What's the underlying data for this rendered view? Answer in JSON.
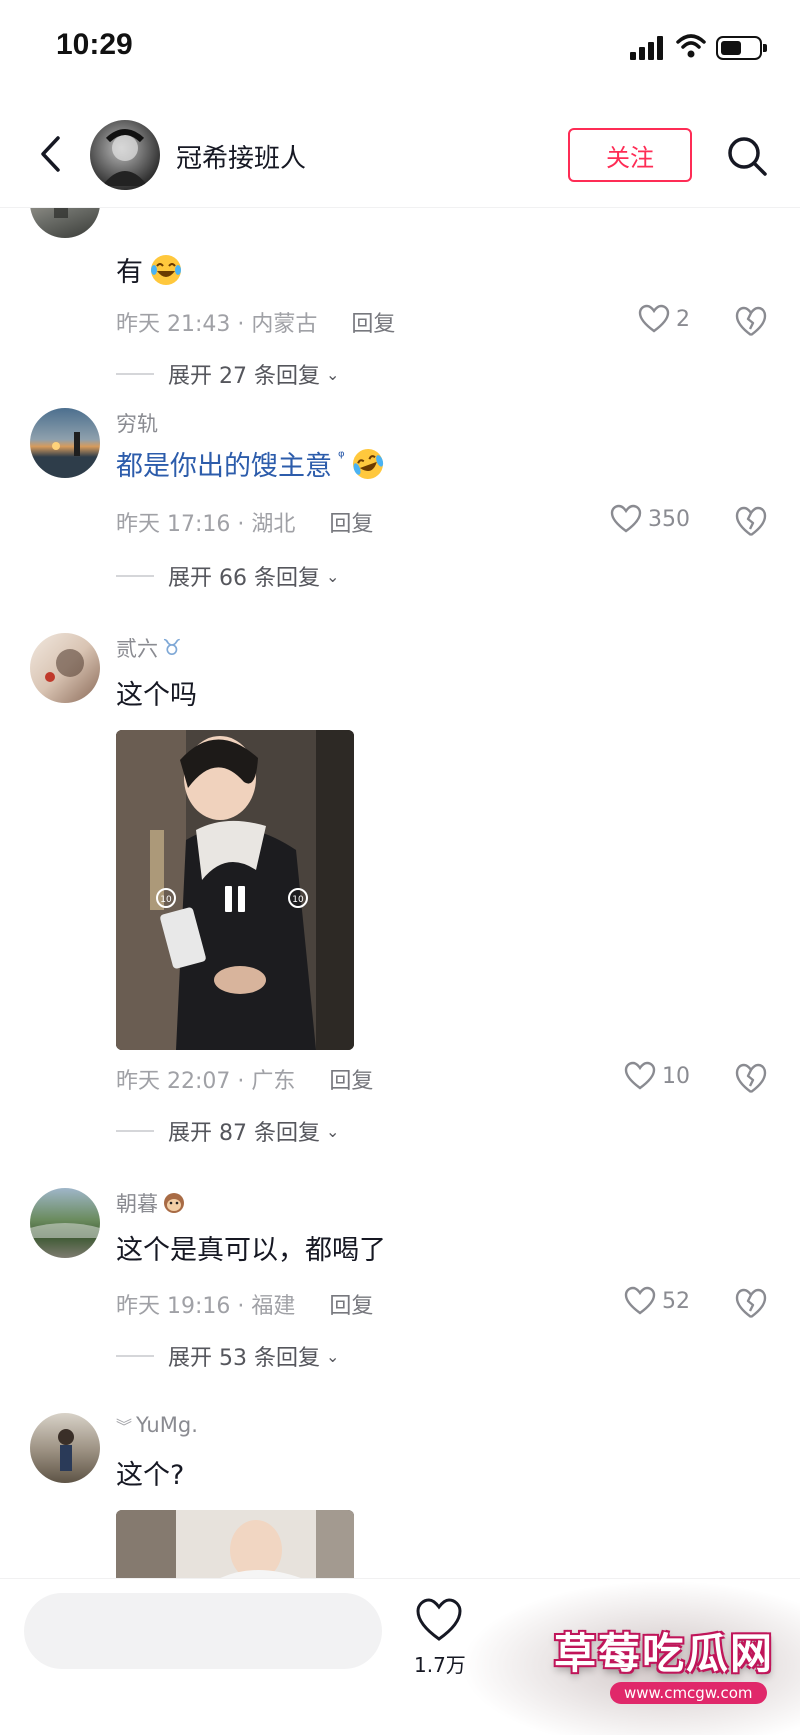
{
  "status_bar": {
    "time": "10:29"
  },
  "header": {
    "account_name": "冠希接班人",
    "follow_label": "关注"
  },
  "comments": [
    {
      "user": "",
      "text": "有",
      "emoji": "laughing-tears",
      "time_location": "昨天 21:43 · 内蒙古",
      "reply_label": "回复",
      "likes": "2",
      "expand_label": "展开 27 条回复"
    },
    {
      "user": "穷轨",
      "text": "都是你出的馊主意",
      "emoji": "crying-laughing",
      "time_location": "昨天 17:16 · 湖北",
      "reply_label": "回复",
      "likes": "350",
      "expand_label": "展开 66 条回复"
    },
    {
      "user": "贰六",
      "text": "这个吗",
      "time_location": "昨天 22:07 · 广东",
      "reply_label": "回复",
      "likes": "10",
      "expand_label": "展开 87 条回复"
    },
    {
      "user": "朝暮",
      "text": "这个是真可以，都喝了",
      "time_location": "昨天 19:16 · 福建",
      "reply_label": "回复",
      "likes": "52",
      "expand_label": "展开 53 条回复"
    },
    {
      "user": "YuMg.",
      "text": "这个?"
    }
  ],
  "bottom_bar": {
    "like_count": "1.7万"
  },
  "watermark": {
    "title": "草莓吃瓜网",
    "url": "www.cmcgw.com"
  },
  "colors": {
    "accent": "#fe2c55",
    "link": "#2c5cab",
    "meta": "#a0a1a6"
  }
}
